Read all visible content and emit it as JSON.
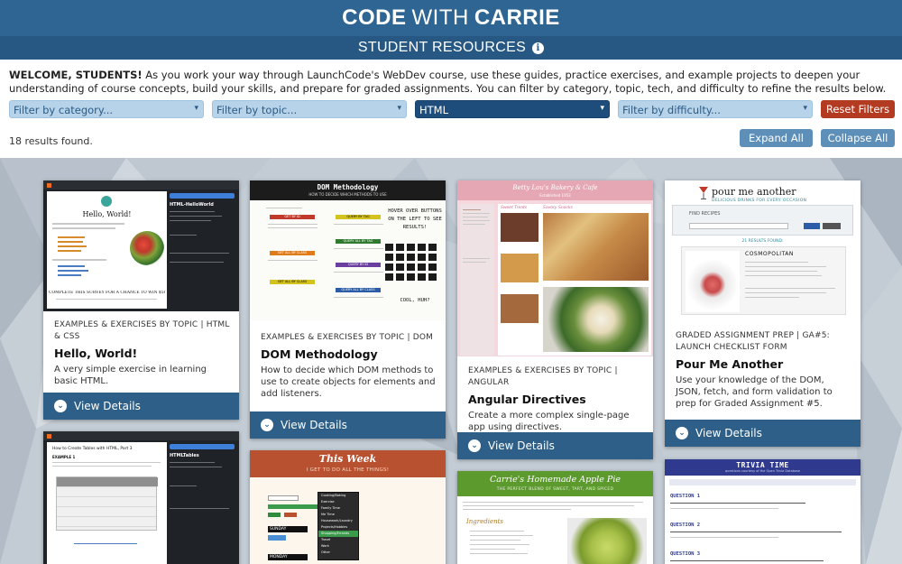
{
  "header": {
    "title_code": "CODE",
    "title_with": "WITH",
    "title_carrie": "CARRIE",
    "subtitle": "STUDENT RESOURCES",
    "info_icon": "info-icon"
  },
  "intro": {
    "welcome": "WELCOME, STUDENTS!",
    "text": "As you work your way through LaunchCode's WebDev course, use these guides, practice exercises, and example projects to deepen your understanding of course concepts, build your skills, and prepare for graded assignments. You can filter by category, topic, tech, and difficulty to refine the results below."
  },
  "filters": {
    "category_placeholder": "Filter by category...",
    "topic_placeholder": "Filter by topic...",
    "tech_selected": "HTML",
    "difficulty_placeholder": "Filter by difficulty...",
    "reset_label": "Reset Filters"
  },
  "results": {
    "count_text": "18 results found.",
    "expand_label": "Expand All",
    "collapse_label": "Collapse All"
  },
  "cards": [
    {
      "category": "EXAMPLES & EXERCISES BY TOPIC | HTML & CSS",
      "title": "Hello, World!",
      "description": "A very simple exercise in learning basic HTML.",
      "button": "View Details",
      "thumb": {
        "page_heading": "Hello, World!",
        "side_title": "HTML-HelloWorld",
        "banner": "COMPLETE THIS SURVEY FOR A CHANCE TO WIN $50 MILLION!!!!"
      }
    },
    {
      "category": "EXAMPLES & EXERCISES BY TOPIC | DOM",
      "title": "DOM Methodology",
      "description": "How to decide which DOM methods to use to create objects for elements and add listeners.",
      "button": "View Details",
      "thumb": {
        "heading": "DOM Methodology",
        "sub": "HOW TO DECIDE WHICH METHODS TO USE",
        "hover_text": "Hover over buttons on the left to see results!",
        "cool": "Cool, huh?",
        "labels": [
          "GET BY ID",
          "QUERY BY TAG",
          "GET ALL BY CLASS",
          "QUERY ALL BY TAG",
          "GET ALL BY CLASS",
          "QUERY BY ID",
          "QUERY ALL BY CLASS"
        ]
      }
    },
    {
      "category": "EXAMPLES & EXERCISES BY TOPIC | ANGULAR",
      "title": "Angular Directives",
      "description": "Create a more complex single-page app using directives.",
      "button": "View Details",
      "thumb": {
        "heading": "Betty Lou's Bakery & Cafe",
        "sub": "Established 1953",
        "col1": "Sweet Treats",
        "col2": "Savory Snacks"
      }
    },
    {
      "category": "GRADED ASSIGNMENT PREP | GA#5: LAUNCH CHECKLIST FORM",
      "title": "Pour Me Another",
      "description": "Use your knowledge of the DOM, JSON, fetch, and form validation to prep for Graded Assignment #5.",
      "button": "View Details",
      "thumb": {
        "heading": "pour me another",
        "sub": "DELICIOUS DRINKS FOR EVERY OCCASION",
        "search_label": "FIND RECIPES",
        "results": "21 RESULTS FOUND:",
        "drink": "COSMOPOLITAN"
      }
    },
    {
      "thumb": {
        "heading": "How to Create Tables with HTML, Part 3",
        "side_title": "HTMLTables",
        "example": "EXAMPLE 1"
      }
    },
    {
      "thumb": {
        "heading": "This Week",
        "sub": "I GET TO DO ALL THE THINGS!",
        "days": [
          "SUNDAY",
          "MONDAY"
        ],
        "options": [
          "Cooking/Baking",
          "Exercise",
          "Family Time",
          "Me Time",
          "Housework/Laundry",
          "Projects/Hobbies",
          "Shopping/Errands",
          "Travel",
          "Work",
          "Other"
        ]
      }
    },
    {
      "thumb": {
        "heading": "Carrie's Homemade Apple Pie",
        "sub": "THE PERFECT BLEND OF SWEET, TART, AND SPICED",
        "section": "Ingredients"
      }
    },
    {
      "thumb": {
        "heading": "TRIVIA TIME",
        "sub": "questions courtesy of the Open Trivia Database",
        "q1": "QUESTION 1",
        "q2": "QUESTION 2",
        "q3": "QUESTION 3"
      }
    }
  ],
  "colors": {
    "title_bar": "#2e6592",
    "sub_bar": "#265883",
    "filter_bg": "#b6d3ea",
    "filter_selected": "#1e4d7b",
    "reset": "#b23b22",
    "details_bar": "#2e5f88"
  }
}
